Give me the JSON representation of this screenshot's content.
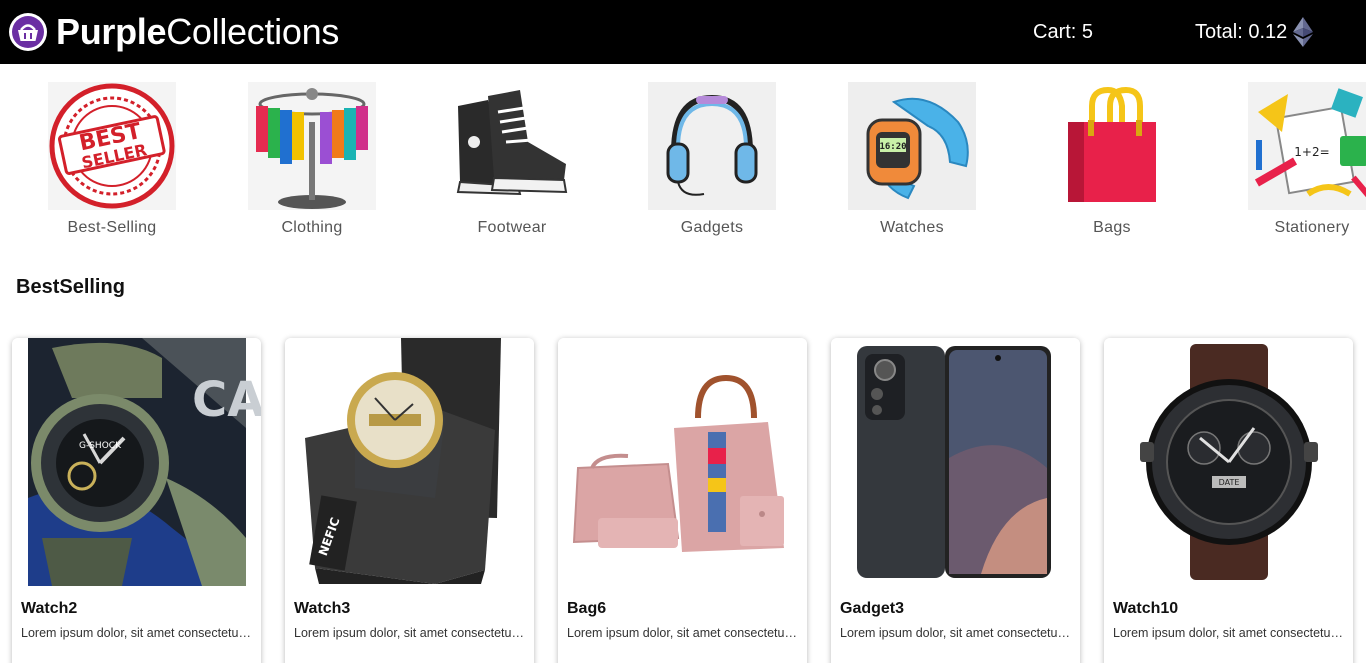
{
  "header": {
    "brand_bold": "Purple",
    "brand_light": "Collections",
    "cart_label": "Cart: 5",
    "total_label": "Total: 0.12",
    "currency_icon": "ethereum-icon"
  },
  "categories": [
    {
      "label": "Best-Selling",
      "icon": "best-seller-stamp"
    },
    {
      "label": "Clothing",
      "icon": "clothing-rack"
    },
    {
      "label": "Footwear",
      "icon": "sneakers"
    },
    {
      "label": "Gadgets",
      "icon": "headphones"
    },
    {
      "label": "Watches",
      "icon": "smartwatch"
    },
    {
      "label": "Bags",
      "icon": "shopping-bag"
    },
    {
      "label": "Stationery",
      "icon": "stationery-items"
    }
  ],
  "section": {
    "title": "BestSelling"
  },
  "products": [
    {
      "name": "Watch2",
      "desc": "Lorem ipsum dolor, sit amet consectetur adipisicing elit."
    },
    {
      "name": "Watch3",
      "desc": "Lorem ipsum dolor, sit amet consectetur adipisicing elit."
    },
    {
      "name": "Bag6",
      "desc": "Lorem ipsum dolor, sit amet consectetur adipisicing elit."
    },
    {
      "name": "Gadget3",
      "desc": "Lorem ipsum dolor, sit amet consectetur adipisicing elit."
    },
    {
      "name": "Watch10",
      "desc": "Lorem ipsum dolor, sit amet consectetur adipisicing elit."
    }
  ],
  "colors": {
    "brand": "#6b2fa3",
    "header_bg": "#000000",
    "bag_red": "#e8214a",
    "bag_handle": "#f5c518"
  }
}
